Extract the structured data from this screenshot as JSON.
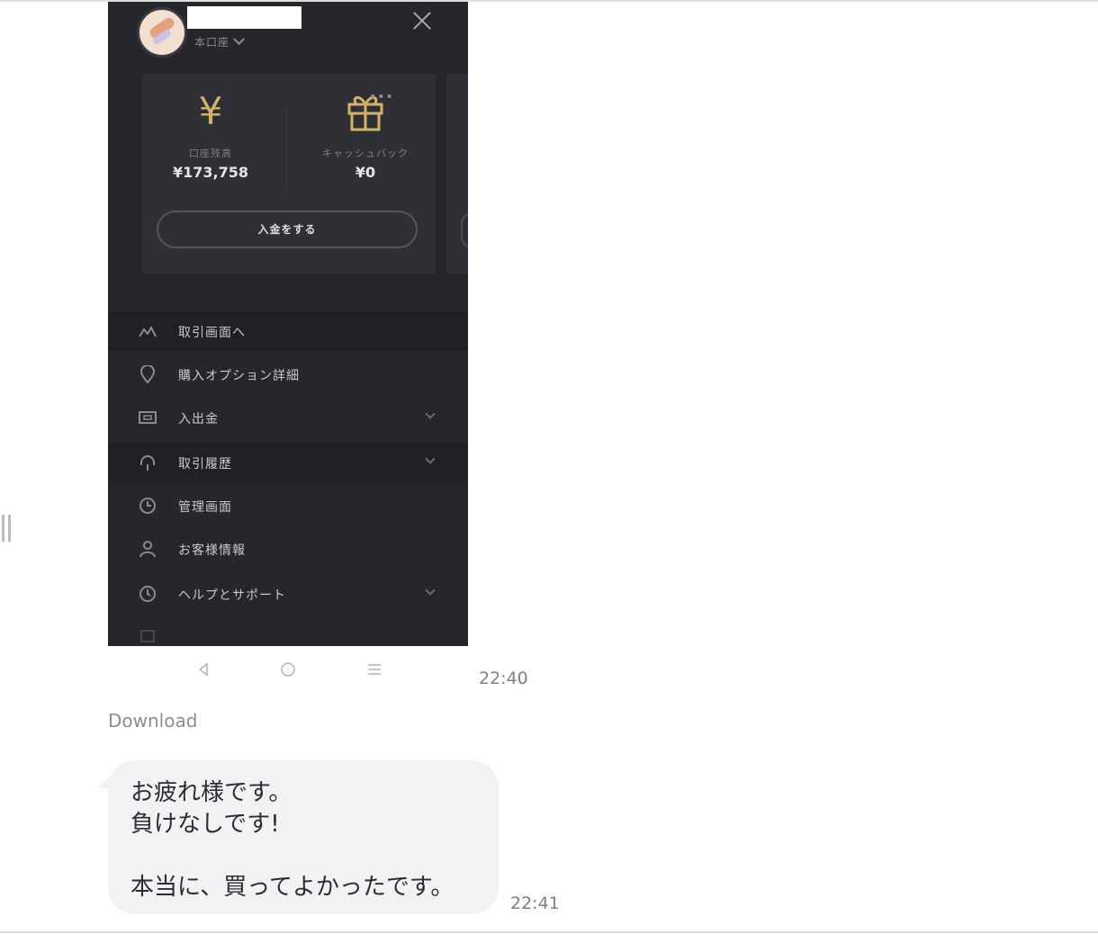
{
  "chat": {
    "image_message": {
      "time": "22:40",
      "download_label": "Download",
      "screenshot": {
        "account_type": "本口座",
        "balances": [
          {
            "label": "口座残高",
            "value": "¥173,758",
            "icon": "yen-icon"
          },
          {
            "label": "キャッシュバック",
            "value": "¥0",
            "icon": "gift-icon"
          }
        ],
        "deposit_button": "入金をする",
        "menu": [
          {
            "label": "取引画面へ",
            "icon": "chart-line-icon"
          },
          {
            "label": "購入オプション詳細",
            "icon": "location-pin-icon"
          },
          {
            "label": "入出金",
            "icon": "wallet-icon",
            "expandable": true
          },
          {
            "label": "取引履歴",
            "icon": "headset-icon",
            "expandable": true
          },
          {
            "label": "管理画面",
            "icon": "clock-icon"
          },
          {
            "label": "お客様情報",
            "icon": "user-icon"
          },
          {
            "label": "ヘルプとサポート",
            "icon": "question-icon",
            "expandable": true
          }
        ]
      }
    },
    "text_message": {
      "lines": [
        "お疲れ様です。",
        "負けなしです!",
        "本当に、買ってよかったです。"
      ],
      "time": "22:41"
    }
  },
  "colors": {
    "app_bg": "#26272b",
    "gold": "#d3b36b",
    "bubble_bg": "#f1f2f4"
  }
}
